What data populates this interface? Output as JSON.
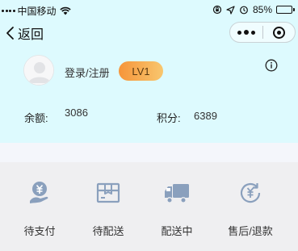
{
  "status_bar": {
    "carrier": "中国移动",
    "battery": "85%",
    "battery_level": 0.85
  },
  "nav": {
    "back_label": "返回"
  },
  "profile": {
    "login_label": "登录/注册",
    "level": "LV1"
  },
  "stats": {
    "balance_label": "余额:",
    "balance_value": "3086",
    "points_label": "积分:",
    "points_value": "6389"
  },
  "orders": [
    {
      "label": "待支付",
      "icon": "payment-icon"
    },
    {
      "label": "待配送",
      "icon": "package-icon"
    },
    {
      "label": "配送中",
      "icon": "truck-icon"
    },
    {
      "label": "售后/退款",
      "icon": "refund-icon"
    }
  ],
  "colors": {
    "header_bg": "#ddfafe",
    "badge_start": "#f6953a",
    "badge_end": "#f8c66e",
    "icon_color": "#8aa0bd"
  }
}
